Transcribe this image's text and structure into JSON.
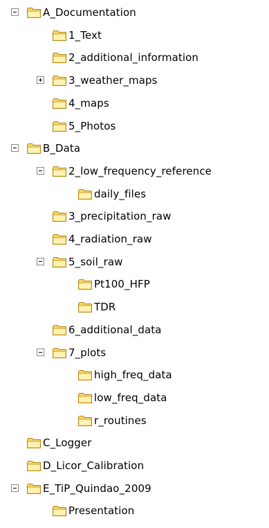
{
  "tree": {
    "items": [
      {
        "label": "A_Documentation",
        "level": 0,
        "toggle": "minus"
      },
      {
        "label": "1_Text",
        "level": 1,
        "toggle": ""
      },
      {
        "label": "2_additional_information",
        "level": 1,
        "toggle": ""
      },
      {
        "label": "3_weather_maps",
        "level": 1,
        "toggle": "plus"
      },
      {
        "label": "4_maps",
        "level": 1,
        "toggle": ""
      },
      {
        "label": "5_Photos",
        "level": 1,
        "toggle": ""
      },
      {
        "label": "B_Data",
        "level": 0,
        "toggle": "minus"
      },
      {
        "label": "2_low_frequency_reference",
        "level": 1,
        "toggle": "minus"
      },
      {
        "label": "daily_files",
        "level": 2,
        "toggle": ""
      },
      {
        "label": "3_precipitation_raw",
        "level": 1,
        "toggle": ""
      },
      {
        "label": "4_radiation_raw",
        "level": 1,
        "toggle": ""
      },
      {
        "label": "5_soil_raw",
        "level": 1,
        "toggle": "minus"
      },
      {
        "label": "Pt100_HFP",
        "level": 2,
        "toggle": ""
      },
      {
        "label": "TDR",
        "level": 2,
        "toggle": ""
      },
      {
        "label": "6_additional_data",
        "level": 1,
        "toggle": ""
      },
      {
        "label": "7_plots",
        "level": 1,
        "toggle": "minus"
      },
      {
        "label": "high_freq_data",
        "level": 2,
        "toggle": ""
      },
      {
        "label": "low_freq_data",
        "level": 2,
        "toggle": ""
      },
      {
        "label": "r_routines",
        "level": 2,
        "toggle": ""
      },
      {
        "label": "C_Logger",
        "level": 0,
        "toggle": ""
      },
      {
        "label": "D_Licor_Calibration",
        "level": 0,
        "toggle": ""
      },
      {
        "label": "E_TiP_Quindao_2009",
        "level": 0,
        "toggle": "minus"
      },
      {
        "label": "Presentation",
        "level": 1,
        "toggle": ""
      }
    ]
  },
  "colors": {
    "folder_body": "#f5d76e",
    "folder_light": "#fff2b3",
    "folder_edge": "#b8860b",
    "toggle_border": "#8a8a8a"
  },
  "icons": {
    "folder": "folder-icon",
    "expanded": "minus-box-icon",
    "collapsed": "plus-box-icon"
  }
}
